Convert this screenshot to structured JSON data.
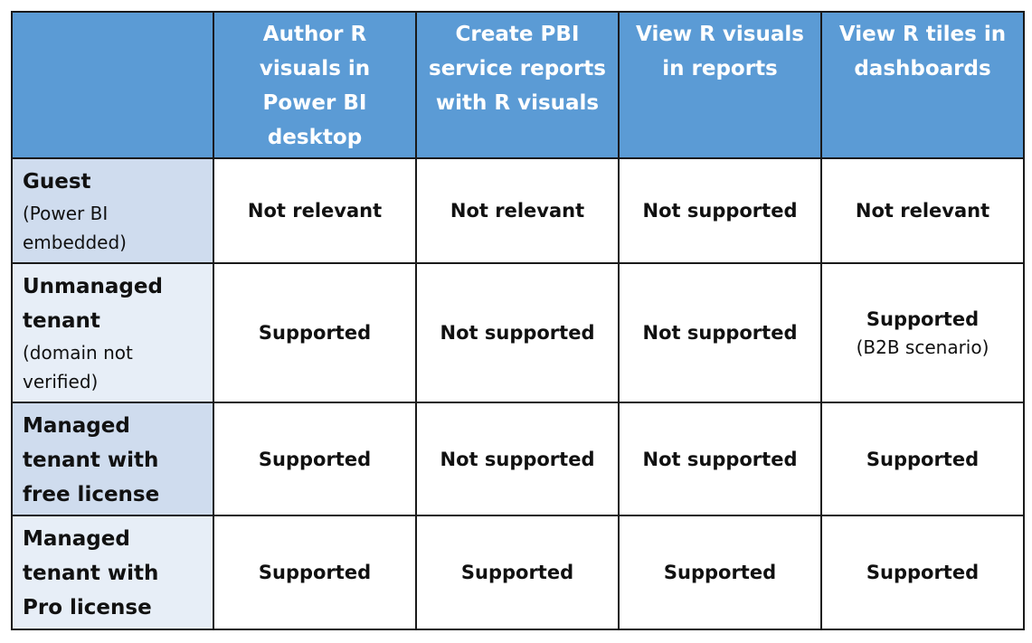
{
  "table": {
    "columns": [
      "Author R visuals in Power BI desktop",
      "Create PBI service reports with R visuals",
      "View R visuals in reports",
      "View R tiles in dashboards"
    ],
    "rows": [
      {
        "title": "Guest",
        "subtitle": "(Power BI embedded)",
        "cells": [
          {
            "value": "Not relevant",
            "note": ""
          },
          {
            "value": "Not relevant",
            "note": ""
          },
          {
            "value": "Not supported",
            "note": ""
          },
          {
            "value": "Not relevant",
            "note": ""
          }
        ]
      },
      {
        "title": "Unmanaged tenant",
        "subtitle": "(domain not verified)",
        "cells": [
          {
            "value": "Supported",
            "note": ""
          },
          {
            "value": "Not supported",
            "note": ""
          },
          {
            "value": "Not supported",
            "note": ""
          },
          {
            "value": "Supported",
            "note": "(B2B scenario)"
          }
        ]
      },
      {
        "title": "Managed tenant with free license",
        "subtitle": "",
        "cells": [
          {
            "value": "Supported",
            "note": ""
          },
          {
            "value": "Not supported",
            "note": ""
          },
          {
            "value": "Not supported",
            "note": ""
          },
          {
            "value": "Supported",
            "note": ""
          }
        ]
      },
      {
        "title": "Managed tenant with Pro license",
        "subtitle": "",
        "cells": [
          {
            "value": "Supported",
            "note": ""
          },
          {
            "value": "Supported",
            "note": ""
          },
          {
            "value": "Supported",
            "note": ""
          },
          {
            "value": "Supported",
            "note": ""
          }
        ]
      }
    ]
  },
  "colors": {
    "header_bg": "#5b9bd5",
    "header_text": "#ffffff",
    "row_header_dark": "#cfdcee",
    "row_header_light": "#e7eef7",
    "border": "#1a1a1a"
  }
}
